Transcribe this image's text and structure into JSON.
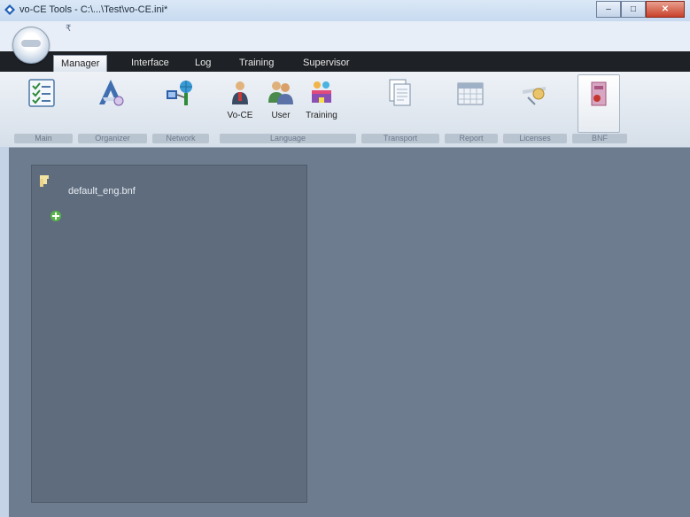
{
  "window": {
    "title": "vo-CE Tools - C:\\...\\Test\\vo-CE.ini*",
    "controls": {
      "minimize": "–",
      "maximize": "□",
      "close": "✕"
    }
  },
  "qat": {
    "dropdown_glyph": "₹"
  },
  "tabs": [
    {
      "label": "Manager",
      "active": true
    },
    {
      "label": "Interface",
      "active": false
    },
    {
      "label": "Log",
      "active": false
    },
    {
      "label": "Training",
      "active": false
    },
    {
      "label": "Supervisor",
      "active": false
    }
  ],
  "ribbon": {
    "groups": {
      "main": "Main",
      "organizer": "Organizer",
      "network": "Network",
      "language": "Language",
      "transport": "Transport",
      "report": "Report",
      "licenses": "Licenses",
      "bnf": "BNF"
    },
    "buttons": {
      "voce": "Vo-CE",
      "user": "User",
      "training": "Training"
    }
  },
  "tree": {
    "file": "default_eng.bnf"
  },
  "icons": {
    "app": "diamond-app-icon",
    "main": "checklist-icon",
    "organizer": "organizer-icon",
    "network": "network-icon",
    "voce": "person-icon",
    "user": "users-icon",
    "training": "training-icon",
    "transport": "documents-icon",
    "report": "calendar-icon",
    "licenses": "key-icon",
    "bnf": "bnf-book-icon",
    "folder": "folder-icon",
    "add": "add-green-icon"
  },
  "colors": {
    "workspace": "#6d7d8f",
    "panel": "#5e6c7d",
    "tabs_strip": "#1e2125",
    "title_bar": "#c7daf0"
  }
}
